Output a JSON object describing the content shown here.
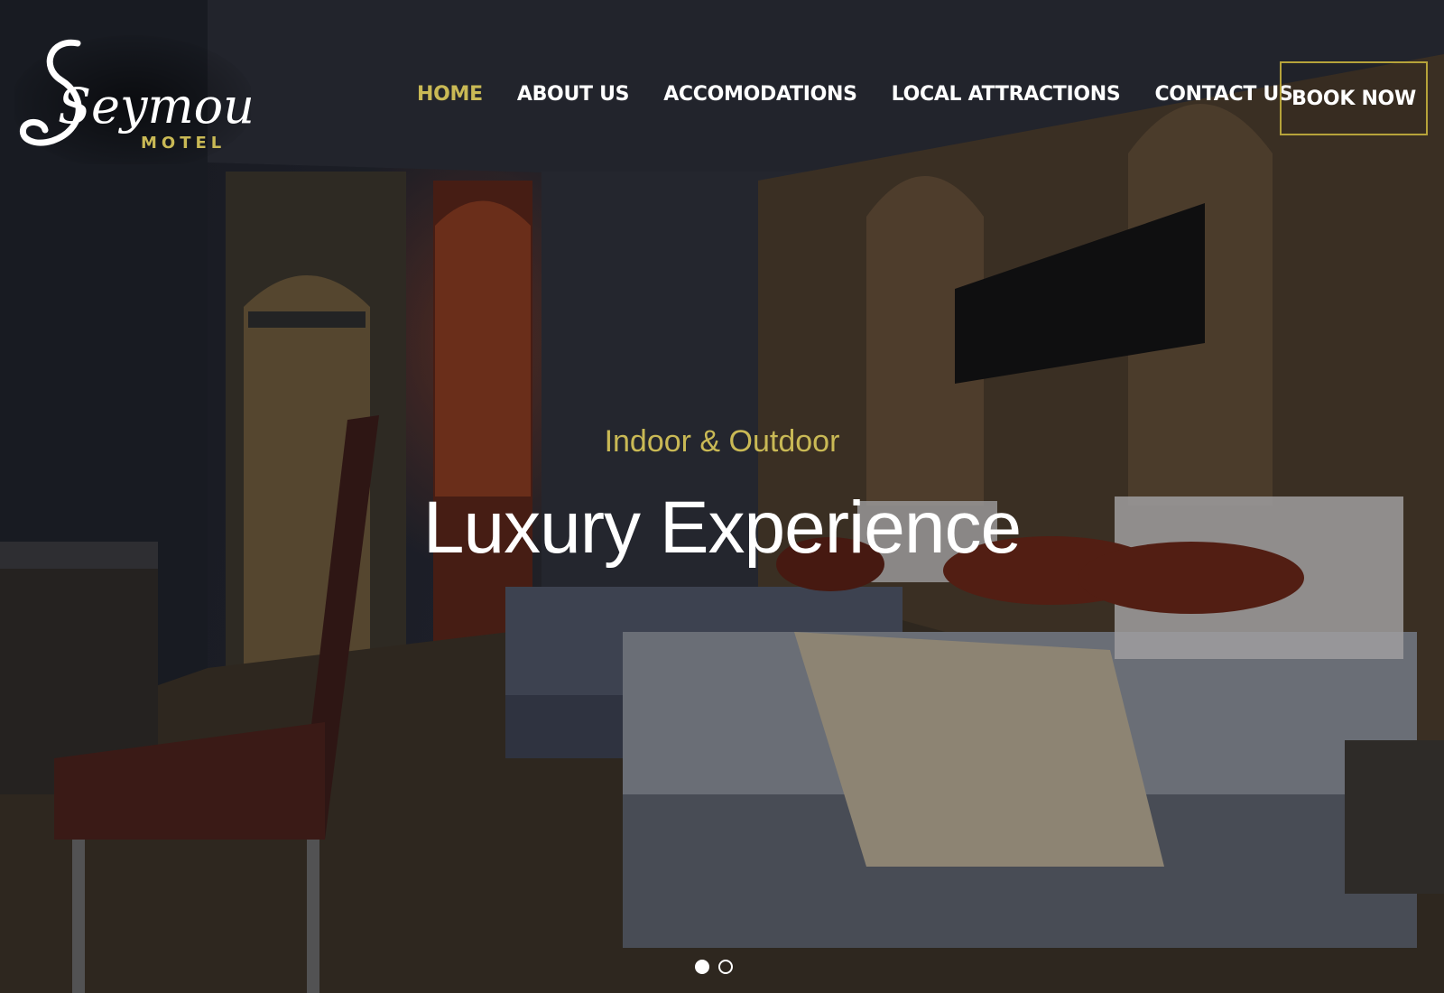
{
  "brand": {
    "script_name": "Seymour",
    "sub_name": "MOTEL",
    "accent_color": "#c9b955"
  },
  "nav": {
    "items": [
      {
        "label": "HOME",
        "active": true
      },
      {
        "label": "ABOUT US",
        "active": false
      },
      {
        "label": "ACCOMODATIONS",
        "active": false
      },
      {
        "label": "LOCAL ATTRACTIONS",
        "active": false
      },
      {
        "label": "CONTACT US",
        "active": false
      }
    ],
    "book_label": "BOOK NOW"
  },
  "hero": {
    "subtitle": "Indoor & Outdoor",
    "title": "Luxury Experience",
    "background": "hotel-room-photo"
  },
  "carousel": {
    "slides": 2,
    "active_index": 0
  }
}
